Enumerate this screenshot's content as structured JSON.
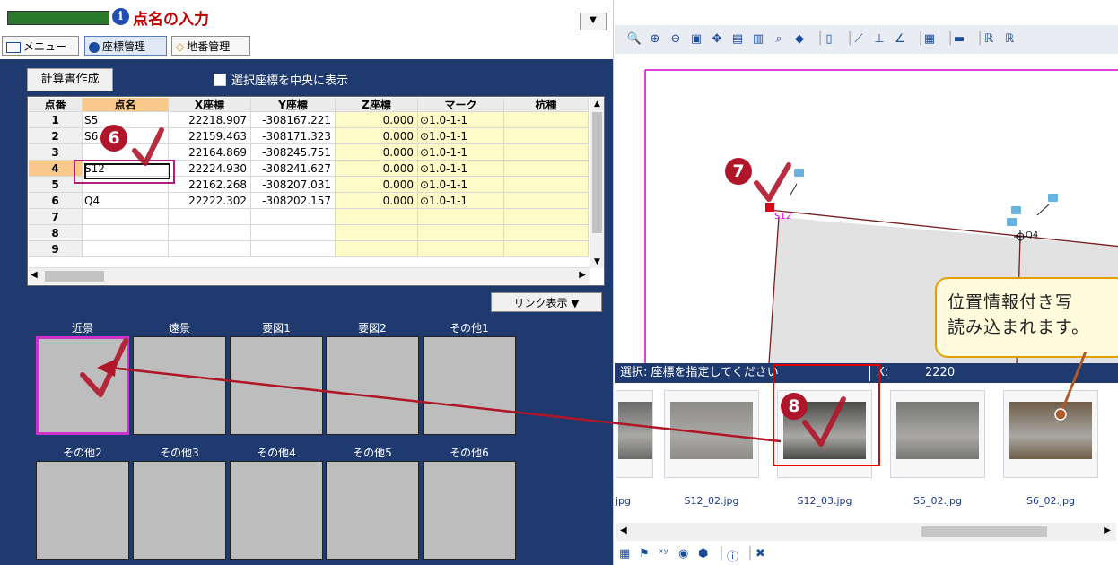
{
  "header": {
    "title": "点名の入力",
    "dropdown_glyph": "▼",
    "tabs": [
      {
        "label": "メニュー",
        "icon": "menu-icon"
      },
      {
        "label": "座標管理",
        "icon": "coordinate-icon",
        "active": true
      },
      {
        "label": "地番管理",
        "icon": "lot-icon"
      }
    ]
  },
  "toolbar": {
    "calc_button": "計算書作成",
    "center_checkbox_label": "選択座標を中央に表示",
    "center_checked": false
  },
  "table": {
    "columns": [
      "点番",
      "点名",
      "X座標",
      "Y座標",
      "Z座標",
      "マーク",
      "杭種"
    ],
    "rows": [
      {
        "no": "1",
        "name": "S5",
        "x": "22218.907",
        "y": "-308167.221",
        "z": "0.000",
        "mark": "⊙1.0-1-1",
        "pile": ""
      },
      {
        "no": "2",
        "name": "S6",
        "x": "22159.463",
        "y": "-308171.323",
        "z": "0.000",
        "mark": "⊙1.0-1-1",
        "pile": ""
      },
      {
        "no": "3",
        "name": "",
        "x": "22164.869",
        "y": "-308245.751",
        "z": "0.000",
        "mark": "⊙1.0-1-1",
        "pile": ""
      },
      {
        "no": "4",
        "name": "S12",
        "x": "22224.930",
        "y": "-308241.627",
        "z": "0.000",
        "mark": "⊙1.0-1-1",
        "pile": ""
      },
      {
        "no": "5",
        "name": "",
        "x": "22162.268",
        "y": "-308207.031",
        "z": "0.000",
        "mark": "⊙1.0-1-1",
        "pile": ""
      },
      {
        "no": "6",
        "name": "Q4",
        "x": "22222.302",
        "y": "-308202.157",
        "z": "0.000",
        "mark": "⊙1.0-1-1",
        "pile": ""
      },
      {
        "no": "7",
        "name": "",
        "x": "",
        "y": "",
        "z": "",
        "mark": "",
        "pile": ""
      },
      {
        "no": "8",
        "name": "",
        "x": "",
        "y": "",
        "z": "",
        "mark": "",
        "pile": ""
      },
      {
        "no": "9",
        "name": "",
        "x": "",
        "y": "",
        "z": "",
        "mark": "",
        "pile": ""
      }
    ],
    "selected_row": 4
  },
  "photos": {
    "link_button": "リンク表示 ▼",
    "slots_top": [
      "近景",
      "遠景",
      "要図1",
      "要図2",
      "その他1"
    ],
    "slots_bottom": [
      "その他2",
      "その他3",
      "その他4",
      "その他5",
      "その他6"
    ]
  },
  "map": {
    "points": [
      "S12",
      "Q4"
    ]
  },
  "status": {
    "message": "選択: 座標を指定してください",
    "x_label": "X:",
    "x_value": "2220"
  },
  "thumbnails": {
    "files": [
      "jpg",
      "S12_02.jpg",
      "S12_03.jpg",
      "S5_02.jpg",
      "S6_02.jpg"
    ],
    "selected": "S12_03.jpg"
  },
  "callout": {
    "line1": "位置情報付き写",
    "line2": "読み込まれます。"
  },
  "badges": [
    "6",
    "7",
    "8"
  ],
  "colors": {
    "title_red": "#c00000",
    "panel_navy": "#1f3a6e",
    "badge_red": "#b0162a",
    "highlight_magenta": "#cc33cc",
    "selected_orange": "#f7c88a",
    "z_yellow": "#fffbc8"
  }
}
